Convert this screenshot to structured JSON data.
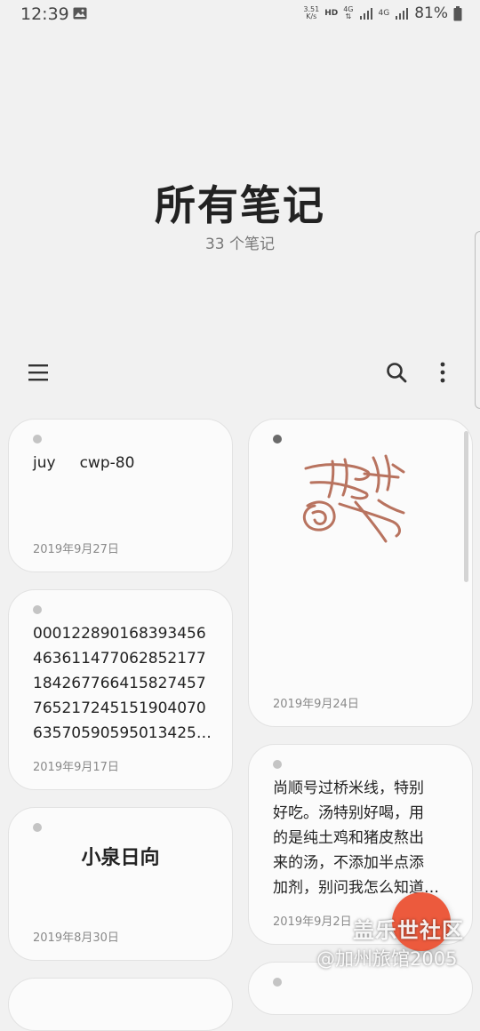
{
  "status_bar": {
    "time": "12:39",
    "net_speed_top": "3.51",
    "net_speed_unit": "K/s",
    "hd": "HD",
    "net_4g_a": "4G",
    "net_4g_b": "4G",
    "battery": "81%"
  },
  "header": {
    "title": "所有笔记",
    "count": "33 个笔记"
  },
  "toolbar": {
    "menu_icon": "menu-icon",
    "search_icon": "search-icon",
    "more_icon": "more-vert-icon"
  },
  "notes": [
    {
      "text": "juy     cwp-80",
      "date": "2019年9月27日"
    },
    {
      "text": "handwritten-drawing",
      "date": "2019年9月24日"
    },
    {
      "lines": [
        "000122890168393456",
        "463611477062852177",
        "184267766415827457",
        "765217245151904070",
        "63570590595013425…"
      ],
      "date": "2019年9月17日"
    },
    {
      "lines": [
        "尚顺号过桥米线，特别",
        "好吃。汤特别好喝，用",
        "的是纯土鸡和猪皮熬出",
        "来的汤，不添加半点添",
        "加剂，别问我怎么知道…"
      ],
      "date": "2019年9月2日"
    },
    {
      "title": "小泉日向",
      "date": "2019年8月30日"
    }
  ],
  "fab": {
    "icon": "add-note-icon",
    "color": "#ec5a3d"
  },
  "watermark": {
    "line1": "盖乐世社区",
    "line2": "@加州旅馆2005"
  }
}
